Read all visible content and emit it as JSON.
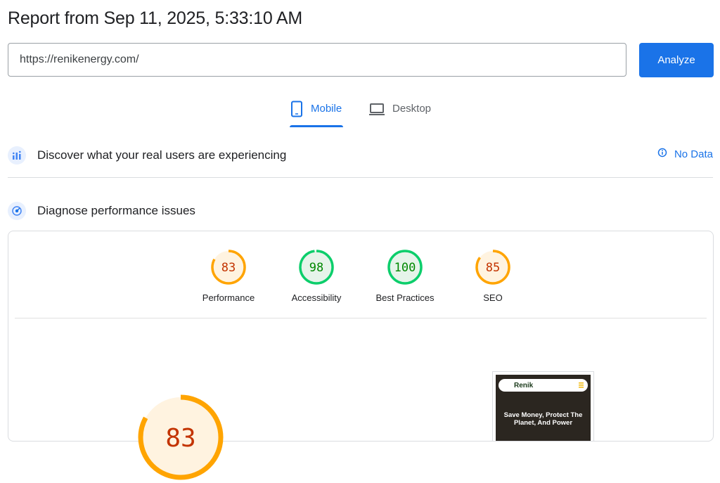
{
  "header": {
    "title": "Report from Sep 11, 2025, 5:33:10 AM"
  },
  "url_input": {
    "value": "https://renikenergy.com/"
  },
  "analyze_label": "Analyze",
  "tabs": [
    {
      "label": "Mobile",
      "active": true,
      "icon": "phone-icon"
    },
    {
      "label": "Desktop",
      "active": false,
      "icon": "laptop-icon"
    }
  ],
  "real_users": {
    "title": "Discover what your real users are experiencing",
    "status": "No Data",
    "icon": "chart-icon"
  },
  "diagnose": {
    "title": "Diagnose performance issues",
    "icon": "gauge-icon"
  },
  "scores": [
    {
      "label": "Performance",
      "value": "83",
      "score": 83,
      "color": "#ffa400",
      "text_color": "#c33300",
      "bg": "#fff3e0"
    },
    {
      "label": "Accessibility",
      "value": "98",
      "score": 98,
      "color": "#0cce6b",
      "text_color": "#008800",
      "bg": "#e6f4ea"
    },
    {
      "label": "Best Practices",
      "value": "100",
      "score": 100,
      "color": "#0cce6b",
      "text_color": "#008800",
      "bg": "#e6f4ea"
    },
    {
      "label": "SEO",
      "value": "85",
      "score": 85,
      "color": "#ffa400",
      "text_color": "#c33300",
      "bg": "#fff3e0"
    }
  ],
  "big_gauge": {
    "value": "83",
    "score": 83
  },
  "screenshot": {
    "logo": "Renik",
    "headline": "Save Money, Protect The Planet, And Power"
  }
}
